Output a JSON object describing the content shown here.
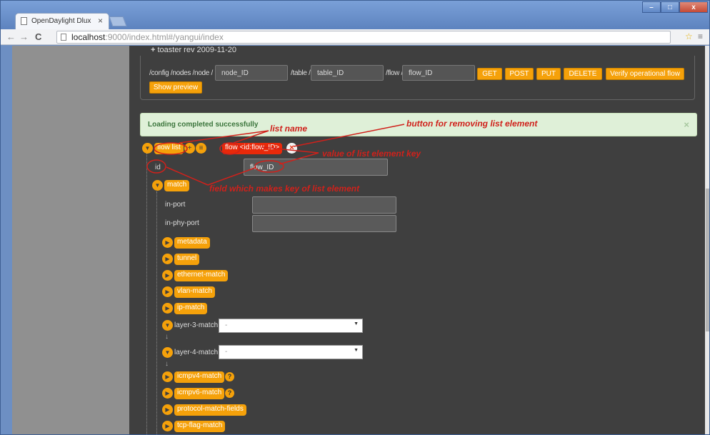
{
  "browser": {
    "tab_title": "OpenDaylight Dlux",
    "tab_close": "×",
    "url_host": "localhost",
    "url_port": ":9000",
    "url_path": "/index.html#/yangui/index",
    "win_min": "–",
    "win_max": "□",
    "win_close": "x",
    "back_icon": "←",
    "forward_icon": "→",
    "reload_icon": "C",
    "star_icon": "☆",
    "menu_icon": "≡"
  },
  "top": {
    "rev": "toaster rev 2009-11-20",
    "path_config": "/config /nodes /node /",
    "node_id": "node_ID",
    "path_table": "/table /",
    "table_id": "table_ID",
    "path_flow": "/flow /",
    "flow_id": "flow_ID",
    "buttons": {
      "get": "GET",
      "post": "POST",
      "put": "PUT",
      "delete": "DELETE",
      "verify": "Verify operational flow"
    },
    "show_preview": "Show preview"
  },
  "alert": {
    "message": "Loading completed successfully",
    "close": "×"
  },
  "tree": {
    "list_name": "flow list",
    "list_element": "flow <id:flow_ID>",
    "id_label": "id",
    "id_value": "flow_ID",
    "match": "match",
    "in_port": "in-port",
    "in_phy_port": "in-phy-port",
    "containers": [
      "metadata",
      "tunnel",
      "ethernet-match",
      "vlan-match",
      "ip-match"
    ],
    "layer3": "layer-3-match",
    "layer4": "layer-4-match",
    "select_placeholder": "-",
    "icmp": [
      "icmpv4-match",
      "icmpv6-match"
    ],
    "protocol": "protocol-match-fields",
    "tcp": "tcp-flag-match"
  },
  "annotations": {
    "list_name": "list name",
    "remove_button": "button for removing list element",
    "key_value": "value of list element key",
    "key_field": "field which makes key of list element"
  },
  "colors": {
    "accent": "#f5a10a",
    "remove": "#e8290a",
    "annotation": "#d0211b",
    "panel": "#3f3f3f"
  }
}
